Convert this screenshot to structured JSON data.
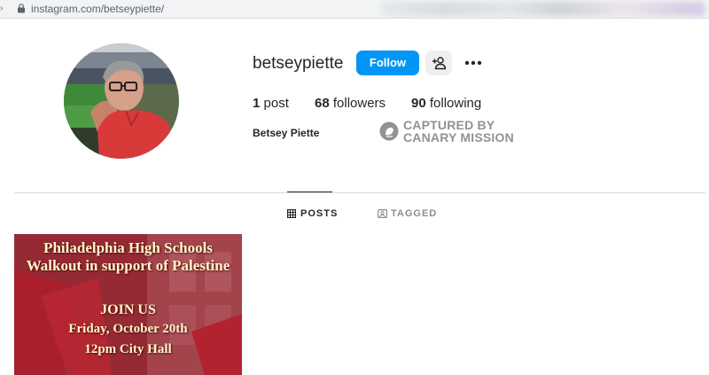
{
  "browser": {
    "url": "instagram.com/betseypiette/"
  },
  "profile": {
    "username": "betseypiette",
    "full_name": "Betsey Piette",
    "follow_label": "Follow",
    "stats": {
      "posts_count": "1",
      "posts_label": "post",
      "followers_count": "68",
      "followers_label": "followers",
      "following_count": "90",
      "following_label": "following"
    }
  },
  "watermark": {
    "line1": "CAPTURED BY",
    "line2": "CANARY MISSION"
  },
  "tabs": [
    {
      "label": "POSTS",
      "icon": "grid-icon",
      "active": true
    },
    {
      "label": "TAGGED",
      "icon": "tagged-icon",
      "active": false
    }
  ],
  "posts": [
    {
      "lines": [
        "Philadelphia High Schools",
        "Walkout in support of Palestine",
        "JOIN US",
        "Friday, October 20th",
        "12pm City Hall"
      ]
    }
  ],
  "colors": {
    "follow_button": "#0095f6",
    "post_background": "#9e2f3a",
    "post_text": "#fff6c8"
  }
}
